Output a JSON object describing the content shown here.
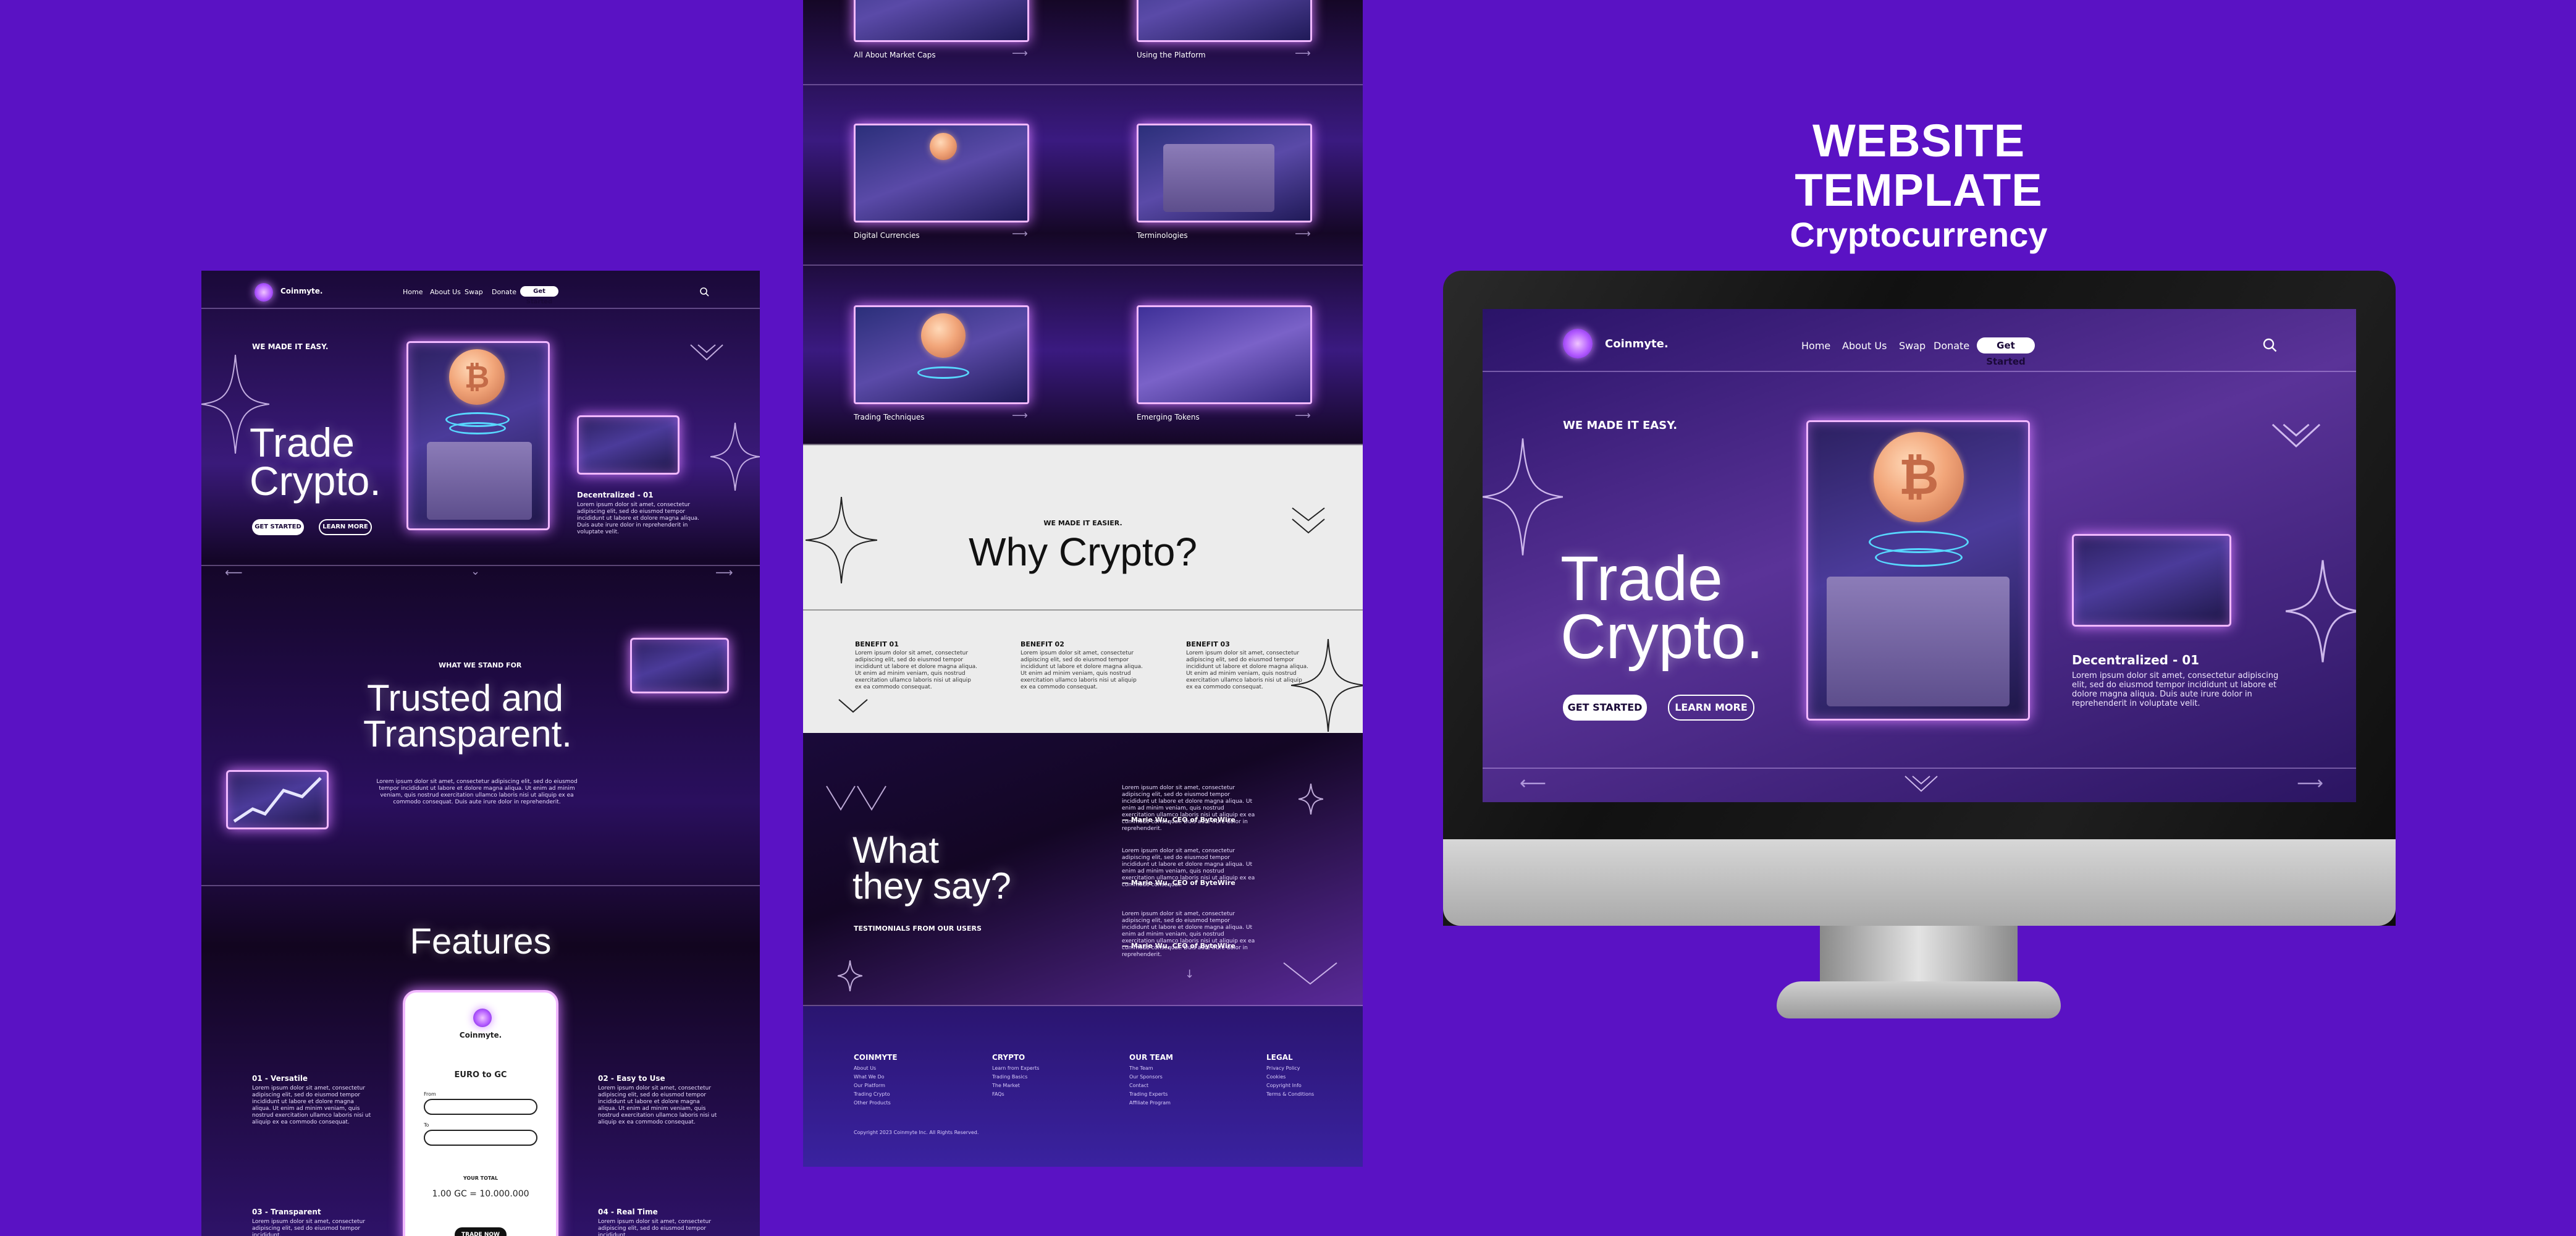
{
  "showcase": {
    "title": "WEBSITE TEMPLATE",
    "subtitle": "Cryptocurrency"
  },
  "brand": "Coinmyte.",
  "nav": {
    "home": "Home",
    "about": "About Us",
    "swap": "Swap",
    "donate": "Donate",
    "cta": "Get Started"
  },
  "hero": {
    "eyebrow": "WE MADE IT EASY.",
    "title_line1": "Trade",
    "title_line2": "Crypto.",
    "btn_primary": "GET STARTED",
    "btn_secondary": "LEARN MORE",
    "card_title": "Decentralized - 01",
    "card_text": "Lorem ipsum dolor sit amet, consectetur adipiscing elit, sed do eiusmod tempor incididunt ut labore et dolore magna aliqua. Duis aute irure dolor in reprehenderit in voluptate velit.",
    "coin_symbol": "₿"
  },
  "stand": {
    "eyebrow": "WHAT WE STAND FOR",
    "title_line1": "Trusted and",
    "title_line2": "Transparent.",
    "text": "Lorem ipsum dolor sit amet, consectetur adipiscing elit, sed do eiusmod tempor incididunt ut labore et dolore magna aliqua. Ut enim ad minim veniam, quis nostrud exercitation ullamco laboris nisi ut aliquip ex ea commodo consequat. Duis aute irure dolor in reprehenderit."
  },
  "features": {
    "title": "Features",
    "items": [
      {
        "title": "01 - Versatile",
        "text": "Lorem ipsum dolor sit amet, consectetur adipiscing elit, sed do eiusmod tempor incididunt ut labore et dolore magna aliqua. Ut enim ad minim veniam, quis nostrud exercitation ullamco laboris nisi ut aliquip ex ea commodo consequat."
      },
      {
        "title": "02 - Easy to Use",
        "text": "Lorem ipsum dolor sit amet, consectetur adipiscing elit, sed do eiusmod tempor incididunt ut labore et dolore magna aliqua. Ut enim ad minim veniam, quis nostrud exercitation ullamco laboris nisi ut aliquip ex ea commodo consequat."
      },
      {
        "title": "03 - Transparent",
        "text": "Lorem ipsum dolor sit amet, consectetur adipiscing elit, sed do eiusmod tempor incididunt."
      },
      {
        "title": "04 - Real Time",
        "text": "Lorem ipsum dolor sit amet, consectetur adipiscing elit, sed do eiusmod tempor incididunt."
      }
    ],
    "phone": {
      "brand": "Coinmyte.",
      "heading": "EURO to GC",
      "field1_label": "From",
      "field2_label": "To",
      "total_label": "YOUR TOTAL",
      "total_value": "1.00 GC = 10.000.000",
      "button": "TRADE NOW"
    }
  },
  "learn": {
    "tiles": [
      {
        "label": "All About Market Caps"
      },
      {
        "label": "Using the Platform"
      },
      {
        "label": "Digital Currencies"
      },
      {
        "label": "Terminologies"
      },
      {
        "label": "Trading Techniques"
      },
      {
        "label": "Emerging Tokens"
      }
    ]
  },
  "why": {
    "eyebrow": "WE MADE IT EASIER.",
    "title": "Why Crypto?",
    "benefits": [
      {
        "title": "BENEFIT 01",
        "text": "Lorem ipsum dolor sit amet, consectetur adipiscing elit, sed do eiusmod tempor incididunt ut labore et dolore magna aliqua. Ut enim ad minim veniam, quis nostrud exercitation ullamco laboris nisi ut aliquip ex ea commodo consequat."
      },
      {
        "title": "BENEFIT 02",
        "text": "Lorem ipsum dolor sit amet, consectetur adipiscing elit, sed do eiusmod tempor incididunt ut labore et dolore magna aliqua. Ut enim ad minim veniam, quis nostrud exercitation ullamco laboris nisi ut aliquip ex ea commodo consequat."
      },
      {
        "title": "BENEFIT 03",
        "text": "Lorem ipsum dolor sit amet, consectetur adipiscing elit, sed do eiusmod tempor incididunt ut labore et dolore magna aliqua. Ut enim ad minim veniam, quis nostrud exercitation ullamco laboris nisi ut aliquip ex ea commodo consequat."
      }
    ]
  },
  "testimonials": {
    "title_line1": "What",
    "title_line2": "they say?",
    "subtitle": "TESTIMONIALS FROM OUR USERS",
    "quotes": [
      {
        "text": "Lorem ipsum dolor sit amet, consectetur adipiscing elit, sed do eiusmod tempor incididunt ut labore et dolore magna aliqua. Ut enim ad minim veniam, quis nostrud exercitation ullamco laboris nisi ut aliquip ex ea commodo consequat. Duis aute irure dolor in reprehenderit.",
        "author": "— Marie Wu, CEO of ByteWire"
      },
      {
        "text": "Lorem ipsum dolor sit amet, consectetur adipiscing elit, sed do eiusmod tempor incididunt ut labore et dolore magna aliqua. Ut enim ad minim veniam, quis nostrud exercitation ullamco laboris nisi ut aliquip ex ea commodo consequat.",
        "author": "— Marie Wu, CEO of ByteWire"
      },
      {
        "text": "Lorem ipsum dolor sit amet, consectetur adipiscing elit, sed do eiusmod tempor incididunt ut labore et dolore magna aliqua. Ut enim ad minim veniam, quis nostrud exercitation ullamco laboris nisi ut aliquip ex ea commodo consequat. Duis aute irure dolor in reprehenderit.",
        "author": "— Marie Wu, CEO of ByteWire"
      }
    ]
  },
  "footer": {
    "columns": [
      {
        "heading": "COINMYTE",
        "items": [
          "About Us",
          "What We Do",
          "Our Platform",
          "Trading Crypto",
          "Other Products"
        ]
      },
      {
        "heading": "CRYPTO",
        "items": [
          "Learn from Experts",
          "Trading Basics",
          "The Market",
          "FAQs"
        ]
      },
      {
        "heading": "OUR TEAM",
        "items": [
          "The Team",
          "Our Sponsors",
          "Contact",
          "Trading Experts",
          "Affiliate Program"
        ]
      },
      {
        "heading": "LEGAL",
        "items": [
          "Privacy Policy",
          "Cookies",
          "Copyright Info",
          "Terms & Conditions"
        ]
      }
    ],
    "copyright": "Copyright 2023 Coinmyte Inc. All Rights Reserved."
  },
  "colors": {
    "background": "#5a12c4",
    "accent_glow": "#f1b8ff",
    "dark_section": "#150726"
  },
  "icons": {
    "search": "search-icon",
    "arrow_left": "arrow-left-icon",
    "arrow_right": "arrow-right-icon",
    "chevron_down": "chevron-down-icon",
    "sparkle": "sparkle-icon"
  }
}
